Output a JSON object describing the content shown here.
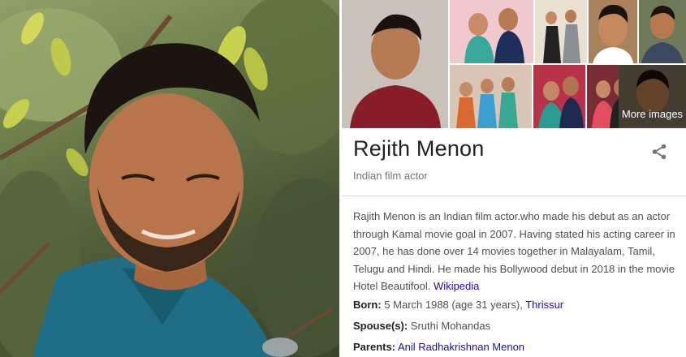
{
  "hero": {
    "icon": "portrait-photo"
  },
  "panel": {
    "more_images_label": "More images",
    "name": "Rejith Menon",
    "entity_type": "Indian film actor",
    "share_icon": "share-icon",
    "description": "Rajith Menon is an Indian film actor.who made his debut as an actor through Kamal movie goal in 2007. Having stated his acting career in 2007, he has done over 14 movies together in Malayalam, Tamil, Telugu and Hindi. He made his Bollywood debut in 2018 in the movie Hotel Beautifool.",
    "source_link": "Wikipedia",
    "facts": {
      "born_label": "Born:",
      "born_value": "5 March 1988 (age 31 years),",
      "born_place": "Thrissur",
      "spouse_label": "Spouse(s):",
      "spouse_value": "Sruthi Mohandas",
      "parents_label": "Parents:",
      "parents_value": "Anil Radhakrishnan Menon"
    }
  },
  "colors": {
    "link": "#1a0dab",
    "title": "#202124",
    "body": "#4d5156",
    "muted": "#70757a",
    "rule": "#dadce0"
  }
}
